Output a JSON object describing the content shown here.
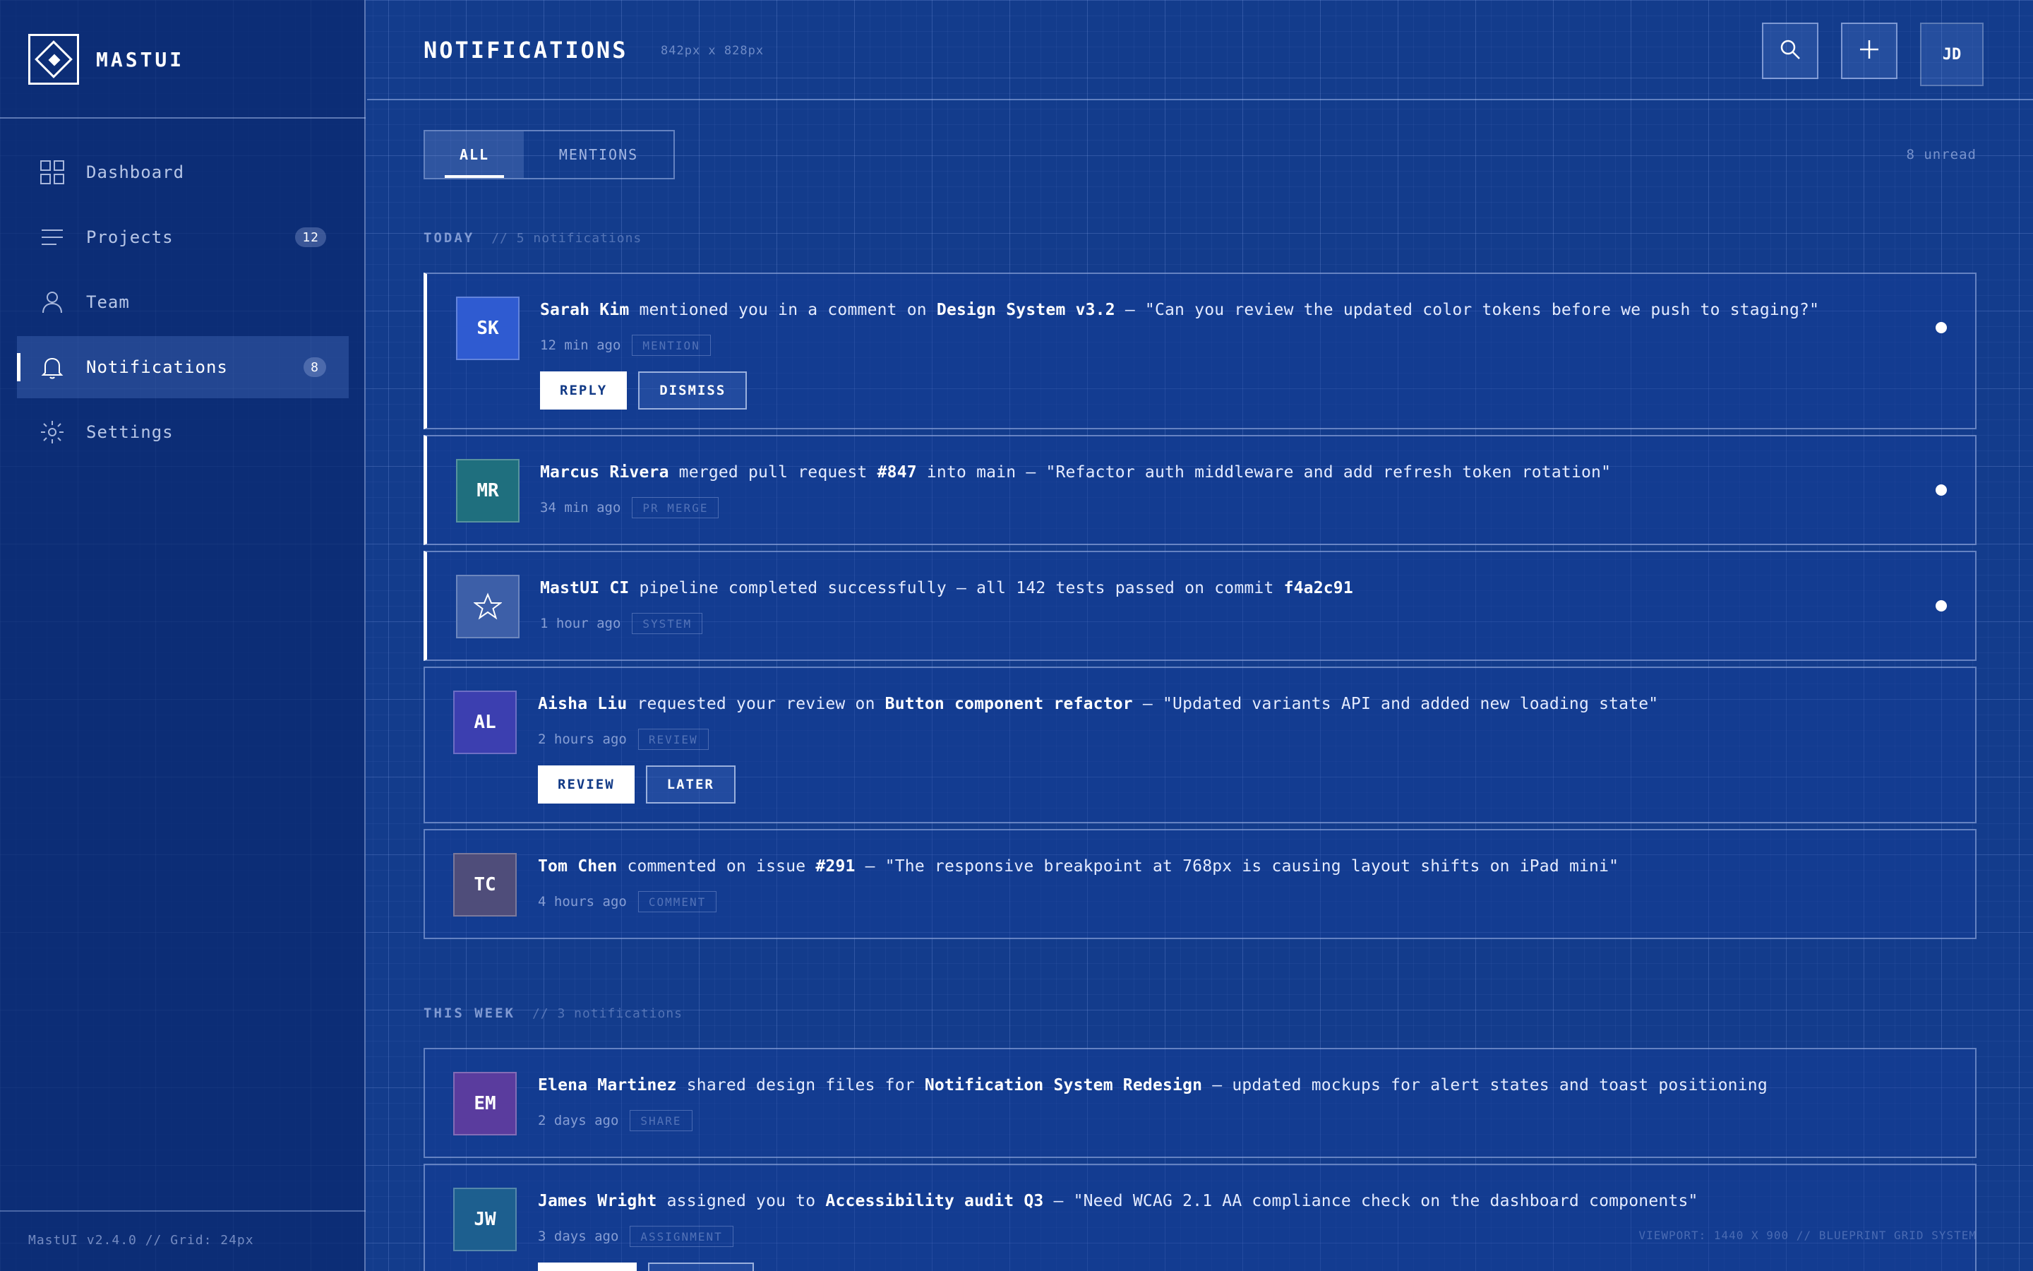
{
  "brand": {
    "name": "MASTUI",
    "logo_icon": "diamond-logo-icon"
  },
  "sidebar": {
    "items": [
      {
        "label": "Dashboard",
        "icon": "grid-icon",
        "active": false
      },
      {
        "label": "Projects",
        "icon": "list-icon",
        "badge": "12",
        "active": false
      },
      {
        "label": "Team",
        "icon": "user-icon",
        "active": false
      },
      {
        "label": "Notifications",
        "icon": "bell-icon",
        "badge": "8",
        "active": true
      },
      {
        "label": "Settings",
        "icon": "gear-icon",
        "active": false
      }
    ],
    "footer": "MastUI v2.4.0 // Grid: 24px"
  },
  "header": {
    "title": "NOTIFICATIONS",
    "dimensions": "842px x 828px",
    "avatar_initials": "JD",
    "icons": [
      "search-icon",
      "plus-icon"
    ]
  },
  "tabs": [
    {
      "label": "ALL",
      "active": true
    },
    {
      "label": "MENTIONS",
      "active": false
    }
  ],
  "unread_label": "8 unread",
  "sections": {
    "today": {
      "title": "TODAY",
      "count": "// 5 notifications"
    },
    "week": {
      "title": "THIS WEEK",
      "count": "// 3 notifications"
    }
  },
  "notifications": [
    {
      "initials": "SK",
      "avatar_color": "#2f5bd1",
      "actor": "Sarah Kim",
      "text1": " mentioned you in a comment on ",
      "target": "Design System v3.2",
      "text2": " — \"Can you review the updated color tokens before we push to staging?\"",
      "time": "12 min ago",
      "tag": "MENTION",
      "unread": true,
      "actions": [
        "REPLY",
        "DISMISS"
      ]
    },
    {
      "initials": "MR",
      "avatar_color": "#1f6f7e",
      "actor": "Marcus Rivera",
      "text1": " merged pull request ",
      "target": "#847",
      "text2": " into main — \"Refactor auth middleware and add refresh token rotation\"",
      "time": "34 min ago",
      "tag": "PR MERGE",
      "unread": true
    },
    {
      "icon": "star-icon",
      "avatar_color": "#3d5fa8",
      "actor": "MastUI CI",
      "text1": " pipeline completed successfully — all 142 tests passed on commit ",
      "target": "f4a2c91",
      "text2": "",
      "time": "1 hour ago",
      "tag": "SYSTEM",
      "unread": true
    },
    {
      "initials": "AL",
      "avatar_color": "#3c3fb0",
      "actor": "Aisha Liu",
      "text1": " requested your review on ",
      "target": "Button component refactor",
      "text2": " — \"Updated variants API and added new loading state\"",
      "time": "2 hours ago",
      "tag": "REVIEW",
      "unread": false,
      "actions": [
        "REVIEW",
        "LATER"
      ]
    },
    {
      "initials": "TC",
      "avatar_color": "#4f4d7a",
      "actor": "Tom Chen",
      "text1": " commented on issue ",
      "target": "#291",
      "text2": " — \"The responsive breakpoint at 768px is causing layout shifts on iPad mini\"",
      "time": "4 hours ago",
      "tag": "COMMENT",
      "unread": false
    },
    {
      "initials": "EM",
      "avatar_color": "#5a3c9e",
      "actor": "Elena Martinez",
      "text1": " shared design files for ",
      "target": "Notification System Redesign",
      "text2": " — updated mockups for alert states and toast positioning",
      "time": "2 days ago",
      "tag": "SHARE",
      "unread": false
    },
    {
      "initials": "JW",
      "avatar_color": "#1d5f8f",
      "actor": "James Wright",
      "text1": " assigned you to ",
      "target": "Accessibility audit Q3",
      "text2": " — \"Need WCAG 2.1 AA compliance check on the dashboard components\"",
      "time": "3 days ago",
      "tag": "ASSIGNMENT",
      "unread": false
    }
  ],
  "viewport_note": "VIEWPORT: 1440 X 900 // BLUEPRINT GRID SYSTEM"
}
